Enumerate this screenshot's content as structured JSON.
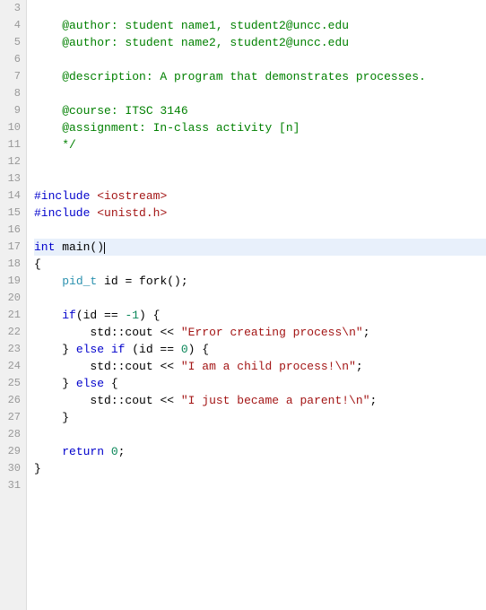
{
  "editor": {
    "title": "Code Editor",
    "lines": [
      {
        "num": 3,
        "content": []
      },
      {
        "num": 4,
        "content": [
          {
            "t": "cm",
            "v": "    @author: student name1, student2@uncc.edu"
          }
        ]
      },
      {
        "num": 5,
        "content": [
          {
            "t": "cm",
            "v": "    @author: student name2, student2@uncc.edu"
          }
        ]
      },
      {
        "num": 6,
        "content": []
      },
      {
        "num": 7,
        "content": [
          {
            "t": "cm",
            "v": "    @description: A program that demonstrates processes."
          }
        ]
      },
      {
        "num": 8,
        "content": []
      },
      {
        "num": 9,
        "content": [
          {
            "t": "cm",
            "v": "    @course: ITSC 3146"
          }
        ]
      },
      {
        "num": 10,
        "content": [
          {
            "t": "cm",
            "v": "    @assignment: In-class activity [n]"
          }
        ]
      },
      {
        "num": 11,
        "content": [
          {
            "t": "cm",
            "v": "    */"
          }
        ]
      },
      {
        "num": 12,
        "content": []
      },
      {
        "num": 13,
        "content": []
      },
      {
        "num": 14,
        "content": [
          {
            "t": "pp",
            "v": "#include"
          },
          {
            "t": "plain",
            "v": " "
          },
          {
            "t": "str",
            "v": "<iostream>"
          }
        ]
      },
      {
        "num": 15,
        "content": [
          {
            "t": "pp",
            "v": "#include"
          },
          {
            "t": "plain",
            "v": " "
          },
          {
            "t": "str",
            "v": "<unistd.h>"
          }
        ]
      },
      {
        "num": 16,
        "content": []
      },
      {
        "num": 17,
        "content": [
          {
            "t": "kw",
            "v": "int"
          },
          {
            "t": "plain",
            "v": " main()"
          },
          {
            "t": "cursor",
            "v": ""
          }
        ],
        "active": true
      },
      {
        "num": 18,
        "content": [
          {
            "t": "plain",
            "v": "{"
          }
        ]
      },
      {
        "num": 19,
        "content": [
          {
            "t": "plain",
            "v": "    "
          },
          {
            "t": "type",
            "v": "pid_t"
          },
          {
            "t": "plain",
            "v": " id = fork();"
          }
        ]
      },
      {
        "num": 20,
        "content": []
      },
      {
        "num": 21,
        "content": [
          {
            "t": "plain",
            "v": "    "
          },
          {
            "t": "kw",
            "v": "if"
          },
          {
            "t": "plain",
            "v": "(id == "
          },
          {
            "t": "num",
            "v": "-1"
          },
          {
            "t": "plain",
            "v": ") {"
          }
        ]
      },
      {
        "num": 22,
        "content": [
          {
            "t": "plain",
            "v": "        "
          },
          {
            "t": "ns",
            "v": "std::cout"
          },
          {
            "t": "plain",
            "v": " << "
          },
          {
            "t": "str",
            "v": "\"Error creating process\\n\""
          },
          {
            "t": "plain",
            "v": ";"
          }
        ]
      },
      {
        "num": 23,
        "content": [
          {
            "t": "plain",
            "v": "    } "
          },
          {
            "t": "kw",
            "v": "else if"
          },
          {
            "t": "plain",
            "v": " (id == "
          },
          {
            "t": "num",
            "v": "0"
          },
          {
            "t": "plain",
            "v": ") {"
          }
        ]
      },
      {
        "num": 24,
        "content": [
          {
            "t": "plain",
            "v": "        "
          },
          {
            "t": "ns",
            "v": "std::cout"
          },
          {
            "t": "plain",
            "v": " << "
          },
          {
            "t": "str",
            "v": "\"I am a child process!\\n\""
          },
          {
            "t": "plain",
            "v": ";"
          }
        ]
      },
      {
        "num": 25,
        "content": [
          {
            "t": "plain",
            "v": "    } "
          },
          {
            "t": "kw",
            "v": "else"
          },
          {
            "t": "plain",
            "v": " {"
          }
        ]
      },
      {
        "num": 26,
        "content": [
          {
            "t": "plain",
            "v": "        "
          },
          {
            "t": "ns",
            "v": "std::cout"
          },
          {
            "t": "plain",
            "v": " << "
          },
          {
            "t": "str",
            "v": "\"I just became a parent!\\n\""
          },
          {
            "t": "plain",
            "v": ";"
          }
        ]
      },
      {
        "num": 27,
        "content": [
          {
            "t": "plain",
            "v": "    }"
          }
        ]
      },
      {
        "num": 28,
        "content": []
      },
      {
        "num": 29,
        "content": [
          {
            "t": "plain",
            "v": "    "
          },
          {
            "t": "kw",
            "v": "return"
          },
          {
            "t": "plain",
            "v": " "
          },
          {
            "t": "num",
            "v": "0"
          },
          {
            "t": "plain",
            "v": ";"
          }
        ]
      },
      {
        "num": 30,
        "content": [
          {
            "t": "plain",
            "v": "}"
          }
        ]
      },
      {
        "num": 31,
        "content": []
      }
    ]
  }
}
